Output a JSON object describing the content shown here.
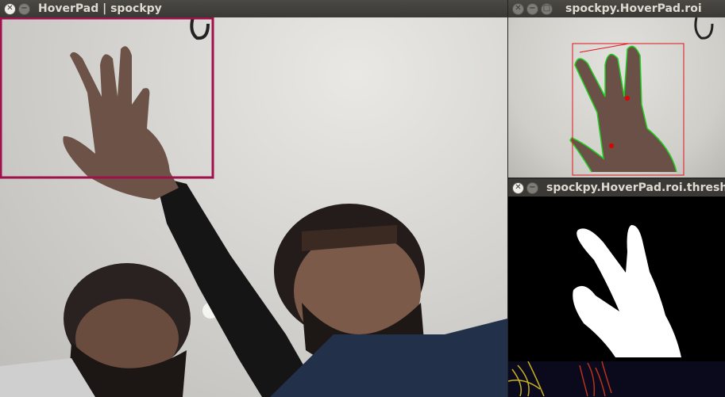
{
  "windows": {
    "main": {
      "title": "HoverPad | spockpy"
    },
    "roi": {
      "title": "spockpy.HoverPad.roi"
    },
    "threshold": {
      "title": "spockpy.HoverPad.roi.thresh"
    }
  },
  "colors": {
    "roi_box": "#a0104a",
    "bounding_box": "#e0141e",
    "contour": "#22cc22",
    "defect_point": "#e00000",
    "titlebar": "#3c3b37",
    "title_text": "#dfdbd2"
  },
  "icons": {
    "close": "close-icon",
    "minimize": "minimize-icon",
    "maximize": "maximize-icon"
  }
}
